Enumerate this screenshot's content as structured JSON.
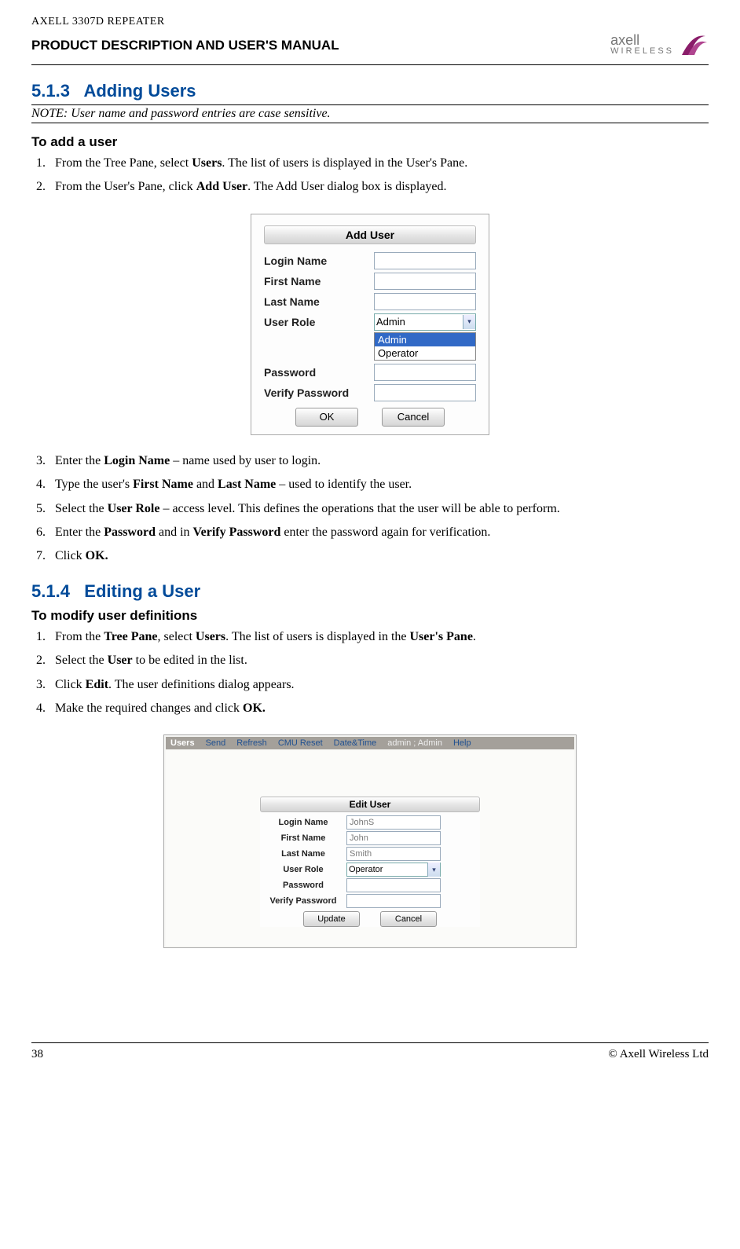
{
  "header": {
    "top_line": "AXELL 3307D REPEATER",
    "subtitle": "PRODUCT DESCRIPTION AND USER'S MANUAL",
    "logo_name": "axell",
    "logo_sub": "WIRELESS"
  },
  "s513": {
    "number": "5.1.3",
    "title": "Adding Users",
    "note": "NOTE: User name and password entries are case sensitive.",
    "subhead": "To add a user",
    "steps_a": [
      {
        "pre": "From the Tree Pane, select ",
        "b": "Users",
        "post": ". The list of users is displayed in the User's Pane."
      },
      {
        "pre": "From the User's Pane, click ",
        "b": "Add User",
        "post": ". The Add User dialog box is displayed."
      }
    ],
    "dialog": {
      "title": "Add User",
      "fields": {
        "login": "Login Name",
        "first": "First Name",
        "last": "Last Name",
        "role": "User Role",
        "password": "Password",
        "verify": "Verify Password"
      },
      "role_value": "Admin",
      "role_options": [
        "Admin",
        "Operator"
      ],
      "ok": "OK",
      "cancel": "Cancel"
    },
    "steps_b": [
      {
        "n": "3.",
        "pre": "Enter the ",
        "b": "Login Name",
        "post": " – name used by user to login."
      },
      {
        "n": "4.",
        "pre": "Type the user's ",
        "b": "First Name",
        "mid": " and ",
        "b2": "Last Name",
        "post": " – used to identify the user."
      },
      {
        "n": "5.",
        "pre": "Select the ",
        "b": "User Role",
        "post": " – access level. This defines the operations that the user will be able to perform."
      },
      {
        "n": "6.",
        "pre": "Enter the ",
        "b": "Password",
        "mid": " and in ",
        "b2": "Verify Password",
        "post": " enter the password again for verification."
      },
      {
        "n": "7.",
        "pre": "Click ",
        "b": "OK.",
        "post": ""
      }
    ]
  },
  "s514": {
    "number": "5.1.4",
    "title": "Editing a User",
    "subhead": "To modify user definitions",
    "steps": [
      {
        "pre": "From the ",
        "b": "Tree Pane",
        "mid": ", select ",
        "b2": "Users",
        "mid2": ". The list of users is displayed in the ",
        "b3": "User's Pane",
        "post": "."
      },
      {
        "pre": "Select the ",
        "b": "User",
        "post": " to be edited in the list."
      },
      {
        "pre": "Click ",
        "b": "Edit",
        "post": ". The user definitions dialog appears."
      },
      {
        "pre": "Make the required changes and click ",
        "b": "OK.",
        "post": ""
      }
    ],
    "toolbar": {
      "label": "Users",
      "links": [
        "Send",
        "Refresh",
        "CMU Reset",
        "Date&Time"
      ],
      "user": "admin ; Admin",
      "help": "Help"
    },
    "dialog": {
      "title": "Edit User",
      "fields": {
        "login": "Login Name",
        "first": "First Name",
        "last": "Last Name",
        "role": "User Role",
        "password": "Password",
        "verify": "Verify Password"
      },
      "values": {
        "login": "JohnS",
        "first": "John",
        "last": "Smith",
        "role": "Operator"
      },
      "update": "Update",
      "cancel": "Cancel"
    }
  },
  "footer": {
    "page": "38",
    "copyright": "© Axell Wireless Ltd"
  }
}
